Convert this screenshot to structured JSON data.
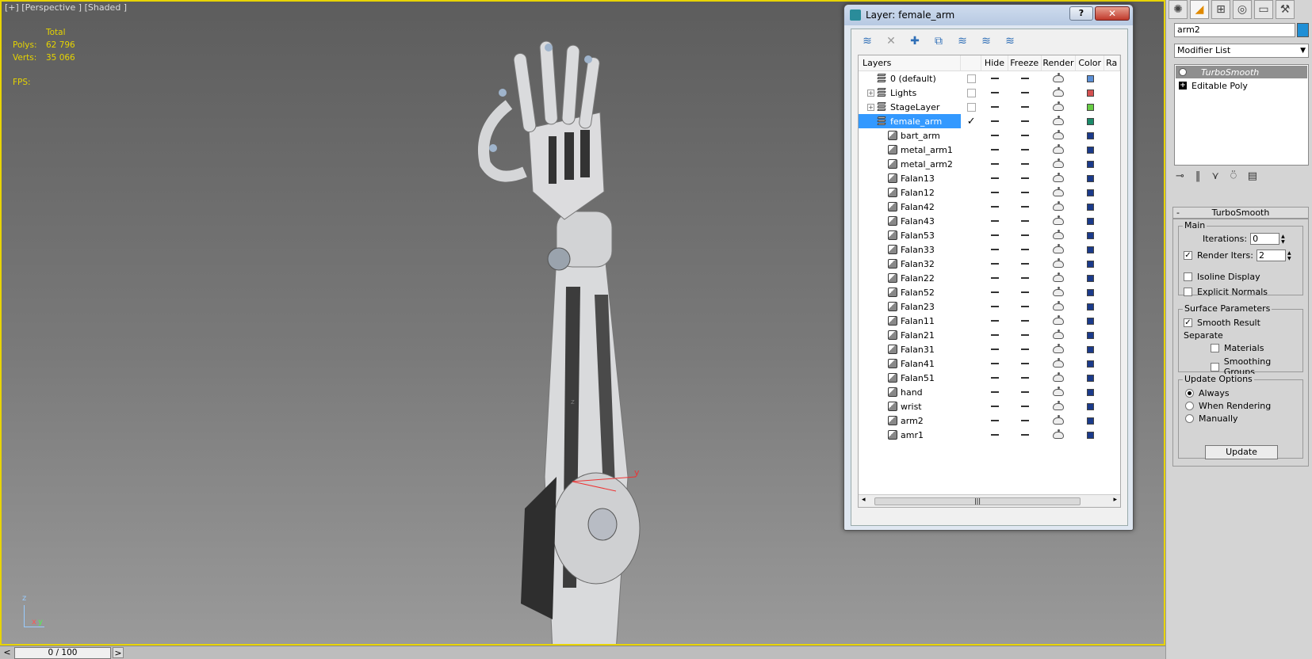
{
  "viewport": {
    "label": "[+] [Perspective ] [Shaded ]",
    "stats": {
      "header": "Total",
      "polys_label": "Polys:",
      "polys": "62 796",
      "verts_label": "Verts:",
      "verts": "35 066",
      "fps_label": "FPS:"
    },
    "axis": {
      "z": "z",
      "x": "x",
      "y": "y"
    }
  },
  "timeline": {
    "prev": "<",
    "value": "0 / 100",
    "next": ">"
  },
  "layer_window": {
    "title": "Layer: female_arm",
    "help": "?",
    "close": "✕",
    "columns": [
      "Layers",
      "",
      "Hide",
      "Freeze",
      "Render",
      "Color",
      "Ra"
    ],
    "layers": [
      {
        "name": "0 (default)",
        "type": "layer",
        "expander": "",
        "current": "checkbox",
        "color": "#5b8fd6"
      },
      {
        "name": "Lights",
        "type": "layer",
        "expander": "+",
        "current": "checkbox",
        "color": "#d45050"
      },
      {
        "name": "StageLayer",
        "type": "layer",
        "expander": "+",
        "current": "checkbox",
        "color": "#66cc44"
      },
      {
        "name": "female_arm",
        "type": "layer",
        "expander": "-",
        "current": "check",
        "selected": true,
        "color": "#1a8a6a"
      },
      {
        "name": "bart_arm",
        "type": "object",
        "color": "#1a3a8a"
      },
      {
        "name": "metal_arm1",
        "type": "object",
        "color": "#1a3a8a"
      },
      {
        "name": "metal_arm2",
        "type": "object",
        "color": "#1a3a8a"
      },
      {
        "name": "Falan13",
        "type": "object",
        "color": "#1a3a8a"
      },
      {
        "name": "Falan12",
        "type": "object",
        "color": "#1a3a8a"
      },
      {
        "name": "Falan42",
        "type": "object",
        "color": "#1a3a8a"
      },
      {
        "name": "Falan43",
        "type": "object",
        "color": "#1a3a8a"
      },
      {
        "name": "Falan53",
        "type": "object",
        "color": "#1a3a8a"
      },
      {
        "name": "Falan33",
        "type": "object",
        "color": "#1a3a8a"
      },
      {
        "name": "Falan32",
        "type": "object",
        "color": "#1a3a8a"
      },
      {
        "name": "Falan22",
        "type": "object",
        "color": "#1a3a8a"
      },
      {
        "name": "Falan52",
        "type": "object",
        "color": "#1a3a8a"
      },
      {
        "name": "Falan23",
        "type": "object",
        "color": "#1a3a8a"
      },
      {
        "name": "Falan11",
        "type": "object",
        "color": "#1a3a8a"
      },
      {
        "name": "Falan21",
        "type": "object",
        "color": "#1a3a8a"
      },
      {
        "name": "Falan31",
        "type": "object",
        "color": "#1a3a8a"
      },
      {
        "name": "Falan41",
        "type": "object",
        "color": "#1a3a8a"
      },
      {
        "name": "Falan51",
        "type": "object",
        "color": "#1a3a8a"
      },
      {
        "name": "hand",
        "type": "object",
        "color": "#1a3a8a"
      },
      {
        "name": "wrist",
        "type": "object",
        "color": "#1a3a8a"
      },
      {
        "name": "arm2",
        "type": "object",
        "color": "#1a3a8a"
      },
      {
        "name": "amr1",
        "type": "object",
        "color": "#1a3a8a"
      }
    ],
    "scroll": {
      "left": "◂",
      "thumb": "|||",
      "right": "▸"
    }
  },
  "command_panel": {
    "object_name": "arm2",
    "object_color": "#1f8fd6",
    "modifier_list": "Modifier List",
    "stack": [
      "TurboSmooth",
      "Editable Poly"
    ],
    "rollout_title": "TurboSmooth",
    "rollout_collapse": "-",
    "main": {
      "title": "Main",
      "iterations_label": "Iterations:",
      "iterations": "0",
      "render_iters_label": "Render Iters:",
      "render_iters": "2",
      "isoline_label": "Isoline Display",
      "explicit_normals_label": "Explicit Normals"
    },
    "surface": {
      "title": "Surface Parameters",
      "smooth_result_label": "Smooth Result",
      "separate_label": "Separate",
      "materials_label": "Materials",
      "smoothing_groups_label": "Smoothing Groups"
    },
    "update": {
      "title": "Update Options",
      "always": "Always",
      "when_rendering": "When Rendering",
      "manually": "Manually",
      "button": "Update"
    }
  }
}
